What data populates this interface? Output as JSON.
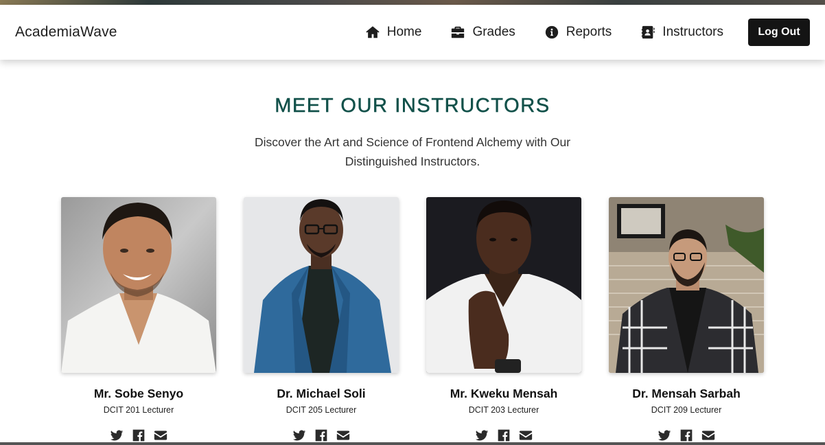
{
  "brand": "AcademiaWave",
  "nav": {
    "items": [
      {
        "label": "Home",
        "icon": "home-icon"
      },
      {
        "label": "Grades",
        "icon": "briefcase-icon"
      },
      {
        "label": "Reports",
        "icon": "info-circle-icon"
      },
      {
        "label": "Instructors",
        "icon": "address-book-icon"
      }
    ],
    "logout_label": "Log Out"
  },
  "hero": {
    "title": "MEET OUR INSTRUCTORS",
    "subtitle": "Discover the Art and Science of Frontend Alchemy with Our Distinguished Instructors."
  },
  "instructors": [
    {
      "name": "Mr. Sobe Senyo",
      "role": "DCIT 201 Lecturer"
    },
    {
      "name": "Dr. Michael Soli",
      "role": "DCIT 205 Lecturer"
    },
    {
      "name": "Mr. Kweku Mensah",
      "role": "DCIT 203 Lecturer"
    },
    {
      "name": "Dr. Mensah Sarbah",
      "role": "DCIT 209 Lecturer"
    }
  ],
  "social_icons": [
    "twitter-icon",
    "facebook-icon",
    "envelope-icon"
  ],
  "colors": {
    "accent": "#12514a",
    "logout_bg": "#141414",
    "text": "#1e1e1e"
  }
}
